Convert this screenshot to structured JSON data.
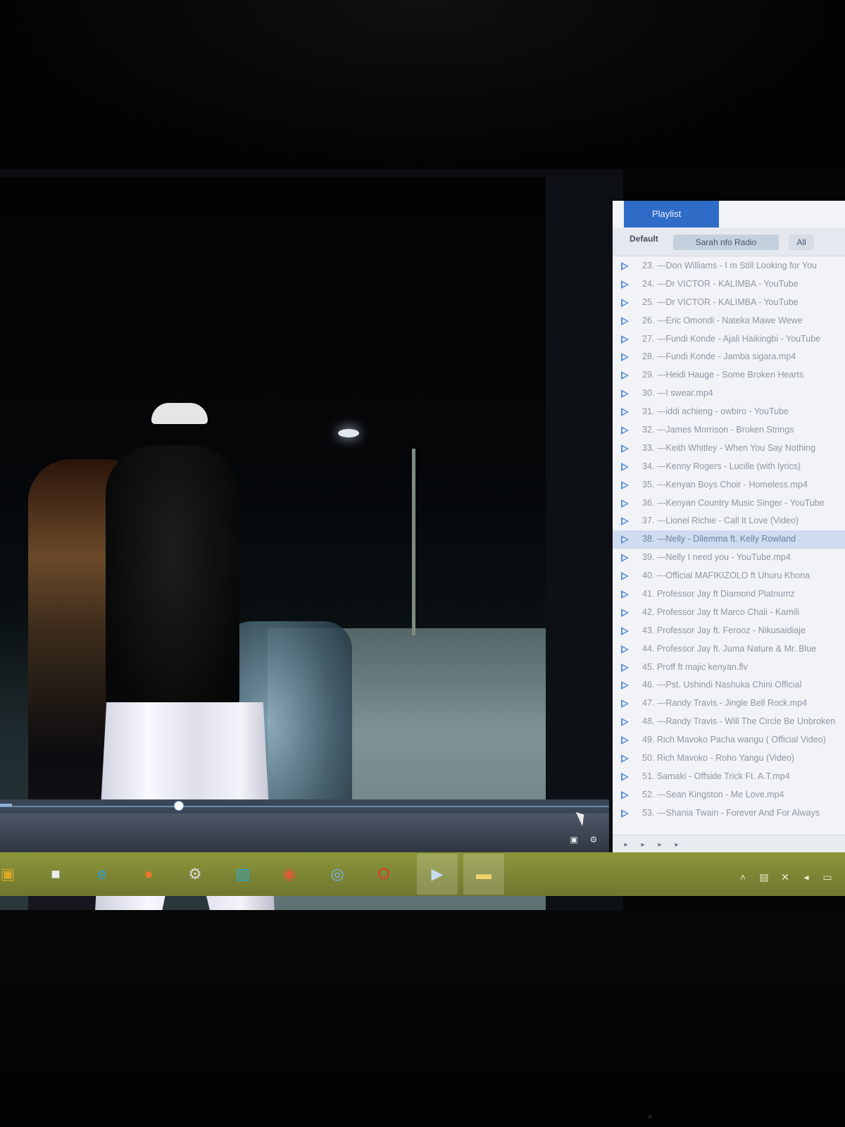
{
  "player": {
    "title": "",
    "seek_progress": 0.02
  },
  "playlist": {
    "window_tab": "Playlist",
    "header": {
      "default_label": "Default",
      "tab_label": "Sarah nfo Radio",
      "tab2_label": "All"
    },
    "items": [
      {
        "label": "23. ---Don Williams - I m Still Looking for You",
        "highlighted": false
      },
      {
        "label": "24. ---Dr VICTOR - KALIMBA - YouTube",
        "highlighted": false
      },
      {
        "label": "25. ---Dr VICTOR - KALIMBA - YouTube",
        "highlighted": false
      },
      {
        "label": "26. ---Eric Omondi - Nateka Mawe Wewe",
        "highlighted": false
      },
      {
        "label": "27. ---Fundi Konde - Ajali Haikingbi - YouTube",
        "highlighted": false
      },
      {
        "label": "28. ---Fundi Konde - Jamba sigara.mp4",
        "highlighted": false
      },
      {
        "label": "29. ---Heidi Hauge - Some Broken Hearts",
        "highlighted": false
      },
      {
        "label": "30. ---I swear.mp4",
        "highlighted": false
      },
      {
        "label": "31. ---iddi achieng - owbiro - YouTube",
        "highlighted": false
      },
      {
        "label": "32. ---James Morrison - Broken Strings",
        "highlighted": false
      },
      {
        "label": "33. ---Keith Whitley - When You Say Nothing",
        "highlighted": false
      },
      {
        "label": "34. ---Kenny Rogers - Lucille (with lyrics)",
        "highlighted": false
      },
      {
        "label": "35. ---Kenyan Boys Choir - Homeless.mp4",
        "highlighted": false
      },
      {
        "label": "36. ---Kenyan Country Music Singer - YouTube",
        "highlighted": false
      },
      {
        "label": "37. ---Lionel Richie - Call It Love (Video)",
        "highlighted": false
      },
      {
        "label": "38. ---Nelly - Dilemma ft. Kelly Rowland",
        "highlighted": true
      },
      {
        "label": "39. ---Nelly I need you - YouTube.mp4",
        "highlighted": false
      },
      {
        "label": "40. ---Official MAFIKIZOLO ft Uhuru Khona",
        "highlighted": false
      },
      {
        "label": "41. Professor Jay ft Diamond Platnumz",
        "highlighted": false
      },
      {
        "label": "42. Professor Jay ft Marco Chali - Kamili",
        "highlighted": false
      },
      {
        "label": "43. Professor Jay ft. Ferooz - Nikusaidiaje",
        "highlighted": false
      },
      {
        "label": "44. Professor Jay ft. Juma Nature & Mr. Blue",
        "highlighted": false
      },
      {
        "label": "45. Proff ft majic kenyan.flv",
        "highlighted": false
      },
      {
        "label": "46. ---Pst. Ushindi Nashuka Chini Official",
        "highlighted": false
      },
      {
        "label": "47. ---Randy Travis - Jingle Bell Rock.mp4",
        "highlighted": false
      },
      {
        "label": "48. ---Randy Travis - Will The Circle Be Unbroken",
        "highlighted": false
      },
      {
        "label": "49. Rich Mavoko Pacha wangu ( Official Video)",
        "highlighted": false
      },
      {
        "label": "50. Rich Mavoko - Roho Yangu (Video)",
        "highlighted": false
      },
      {
        "label": "51. Samaki - Offside Trick Ft. A.T.mp4",
        "highlighted": false
      },
      {
        "label": "52. ---Sean Kingston - Me Love.mp4",
        "highlighted": false
      },
      {
        "label": "53. ---Shania Twain - Forever And For Always",
        "highlighted": false
      }
    ]
  },
  "taskbar": {
    "items": [
      {
        "name": "start-button",
        "icon": "windows-logo-icon",
        "glyph": "▣",
        "color": "#d9a52a"
      },
      {
        "name": "taskbar-app-store",
        "icon": "store-cube-icon",
        "glyph": "■",
        "color": "#e9ecf0"
      },
      {
        "name": "taskbar-internet-explorer",
        "icon": "internet-explorer-icon",
        "glyph": "e",
        "color": "#2a9fe0"
      },
      {
        "name": "taskbar-firefox",
        "icon": "firefox-icon",
        "glyph": "●",
        "color": "#e6782a"
      },
      {
        "name": "taskbar-settings",
        "icon": "gear-icon",
        "glyph": "⚙",
        "color": "#d8d8d8"
      },
      {
        "name": "taskbar-photos",
        "icon": "photos-icon",
        "glyph": "▧",
        "color": "#2aa7c6"
      },
      {
        "name": "taskbar-chrome",
        "icon": "chrome-icon",
        "glyph": "◉",
        "color": "#e25a3a"
      },
      {
        "name": "taskbar-blue-app",
        "icon": "globe-icon",
        "glyph": "◎",
        "color": "#7ab4e8"
      },
      {
        "name": "taskbar-opera",
        "icon": "opera-icon",
        "glyph": "O",
        "color": "#e2362a"
      },
      {
        "name": "taskbar-media-player",
        "icon": "media-player-icon",
        "glyph": "▶",
        "color": "#c8dcef",
        "active": true
      },
      {
        "name": "taskbar-file-explorer",
        "icon": "folder-icon",
        "glyph": "▬",
        "color": "#f2d36b",
        "active": true
      }
    ],
    "tray": [
      {
        "name": "tray-chevron",
        "icon": "chevron-up-icon",
        "glyph": "˄"
      },
      {
        "name": "tray-network",
        "icon": "network-icon",
        "glyph": "▤"
      },
      {
        "name": "tray-battery",
        "icon": "battery-icon",
        "glyph": "✕"
      },
      {
        "name": "tray-volume",
        "icon": "speaker-icon",
        "glyph": "◂"
      },
      {
        "name": "tray-notifications",
        "icon": "notification-icon",
        "glyph": "▭"
      }
    ]
  }
}
